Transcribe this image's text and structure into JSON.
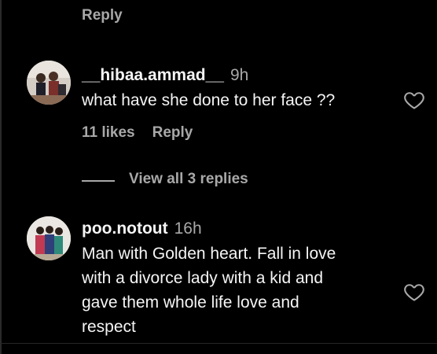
{
  "top_reply": "Reply",
  "comments": [
    {
      "username": "__hibaa.ammad__",
      "time": "9h",
      "text": "what have she done to her face ??",
      "likes": "11 likes",
      "reply": "Reply",
      "view_replies": "View all 3 replies"
    },
    {
      "username": "poo.notout",
      "time": "16h",
      "text_lines": [
        "Man with Golden heart. Fall in love",
        "with a divorce lady with a kid and",
        "gave them whole life love and",
        "respect"
      ]
    }
  ]
}
